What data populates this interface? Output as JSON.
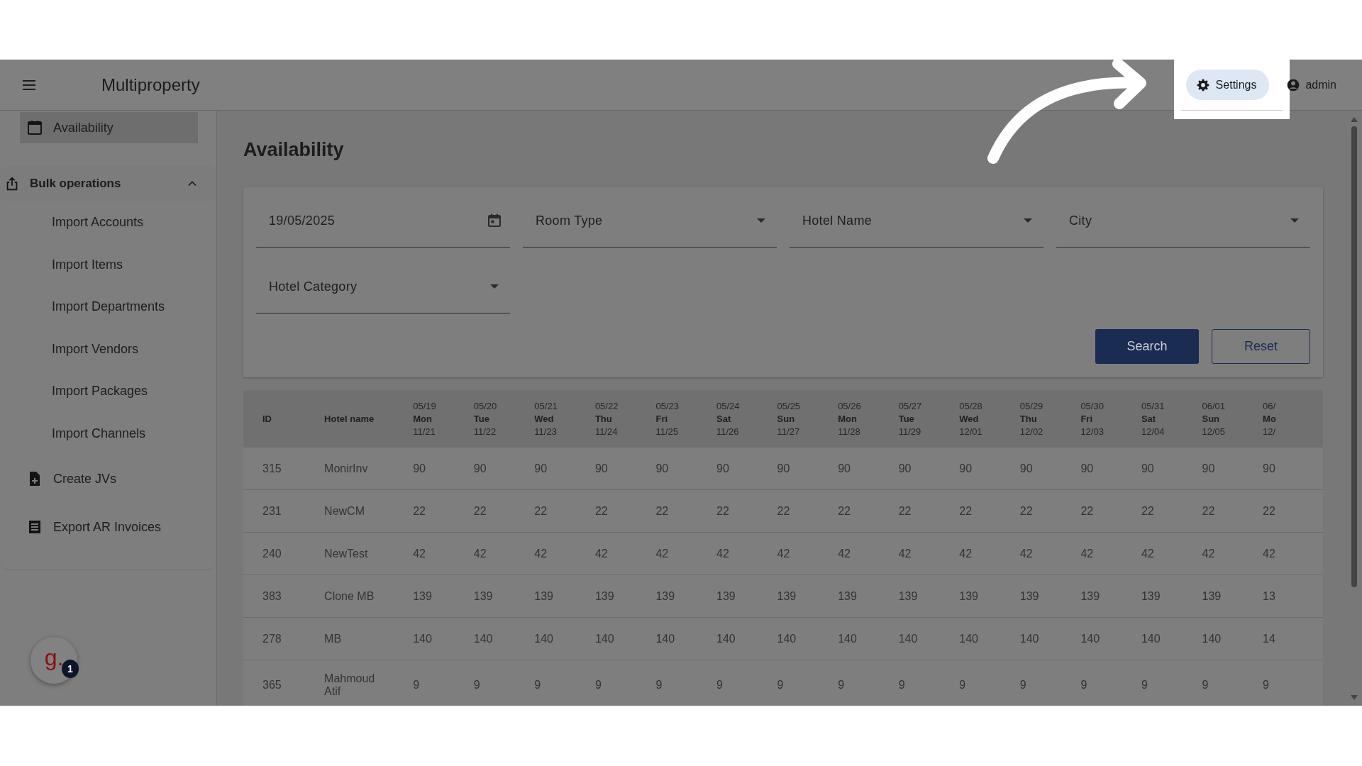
{
  "header": {
    "app_title": "Multiproperty",
    "settings_button": "Settings",
    "user": "admin"
  },
  "sidebar": {
    "items": [
      {
        "kind": "link",
        "label": "Availability",
        "selected": true
      },
      {
        "kind": "group",
        "label": "Bulk operations",
        "expanded": true,
        "children": [
          {
            "label": "Import Accounts",
            "selected": false
          },
          {
            "label": "Import Items",
            "selected": false
          },
          {
            "label": "Import Departments",
            "selected": false
          },
          {
            "label": "Import Vendors",
            "selected": false
          },
          {
            "label": "Import Packages",
            "selected": false
          },
          {
            "label": "Import Channels",
            "selected": false
          }
        ]
      },
      {
        "kind": "link",
        "label": "Create JVs",
        "selected": false
      },
      {
        "kind": "link",
        "label": "Export AR Invoices",
        "selected": false
      }
    ]
  },
  "chat_widget": {
    "logo": "g.",
    "badge": "1"
  },
  "page_title": "Availability",
  "filters": [
    {
      "kind": "date",
      "value": "19/05/2025"
    },
    {
      "kind": "select",
      "placeholder": "Room Type"
    },
    {
      "kind": "select",
      "placeholder": "Hotel Name"
    },
    {
      "kind": "select",
      "placeholder": "City"
    },
    {
      "kind": "select",
      "placeholder": "Hotel Category"
    }
  ],
  "buttons": [
    {
      "kind": "primary",
      "label": "Search"
    },
    {
      "kind": "outlined",
      "label": "Reset"
    }
  ],
  "table": {
    "columns": [
      "ID",
      "Hotel name"
    ],
    "date_columns": [
      {
        "date": "05/19",
        "weekday": "Mon",
        "alt_date": "11/21"
      },
      {
        "date": "05/20",
        "weekday": "Tue",
        "alt_date": "11/22"
      },
      {
        "date": "05/21",
        "weekday": "Wed",
        "alt_date": "11/23"
      },
      {
        "date": "05/22",
        "weekday": "Thu",
        "alt_date": "11/24"
      },
      {
        "date": "05/23",
        "weekday": "Fri",
        "alt_date": "11/25"
      },
      {
        "date": "05/24",
        "weekday": "Sat",
        "alt_date": "11/26"
      },
      {
        "date": "05/25",
        "weekday": "Sun",
        "alt_date": "11/27"
      },
      {
        "date": "05/26",
        "weekday": "Mon",
        "alt_date": "11/28"
      },
      {
        "date": "05/27",
        "weekday": "Tue",
        "alt_date": "11/29"
      },
      {
        "date": "05/28",
        "weekday": "Wed",
        "alt_date": "12/01"
      },
      {
        "date": "05/29",
        "weekday": "Thu",
        "alt_date": "12/02"
      },
      {
        "date": "05/30",
        "weekday": "Fri",
        "alt_date": "12/03"
      },
      {
        "date": "05/31",
        "weekday": "Sat",
        "alt_date": "12/04"
      },
      {
        "date": "06/01",
        "weekday": "Sun",
        "alt_date": "12/05"
      },
      {
        "date": "06/",
        "weekday": "Mo",
        "alt_date": "12/"
      }
    ],
    "rows": [
      {
        "id": "315",
        "hotel": "MonirInv",
        "values": [
          "90",
          "90",
          "90",
          "90",
          "90",
          "90",
          "90",
          "90",
          "90",
          "90",
          "90",
          "90",
          "90",
          "90",
          "90"
        ]
      },
      {
        "id": "231",
        "hotel": "NewCM",
        "values": [
          "22",
          "22",
          "22",
          "22",
          "22",
          "22",
          "22",
          "22",
          "22",
          "22",
          "22",
          "22",
          "22",
          "22",
          "22"
        ]
      },
      {
        "id": "240",
        "hotel": "NewTest",
        "values": [
          "42",
          "42",
          "42",
          "42",
          "42",
          "42",
          "42",
          "42",
          "42",
          "42",
          "42",
          "42",
          "42",
          "42",
          "42"
        ]
      },
      {
        "id": "383",
        "hotel": "Clone MB",
        "values": [
          "139",
          "139",
          "139",
          "139",
          "139",
          "139",
          "139",
          "139",
          "139",
          "139",
          "139",
          "139",
          "139",
          "139",
          "13"
        ]
      },
      {
        "id": "278",
        "hotel": "MB",
        "values": [
          "140",
          "140",
          "140",
          "140",
          "140",
          "140",
          "140",
          "140",
          "140",
          "140",
          "140",
          "140",
          "140",
          "140",
          "14"
        ]
      },
      {
        "id": "365",
        "hotel": "Mahmoud Atif",
        "values": [
          "9",
          "9",
          "9",
          "9",
          "9",
          "9",
          "9",
          "9",
          "9",
          "9",
          "9",
          "9",
          "9",
          "9",
          "9"
        ]
      }
    ]
  }
}
